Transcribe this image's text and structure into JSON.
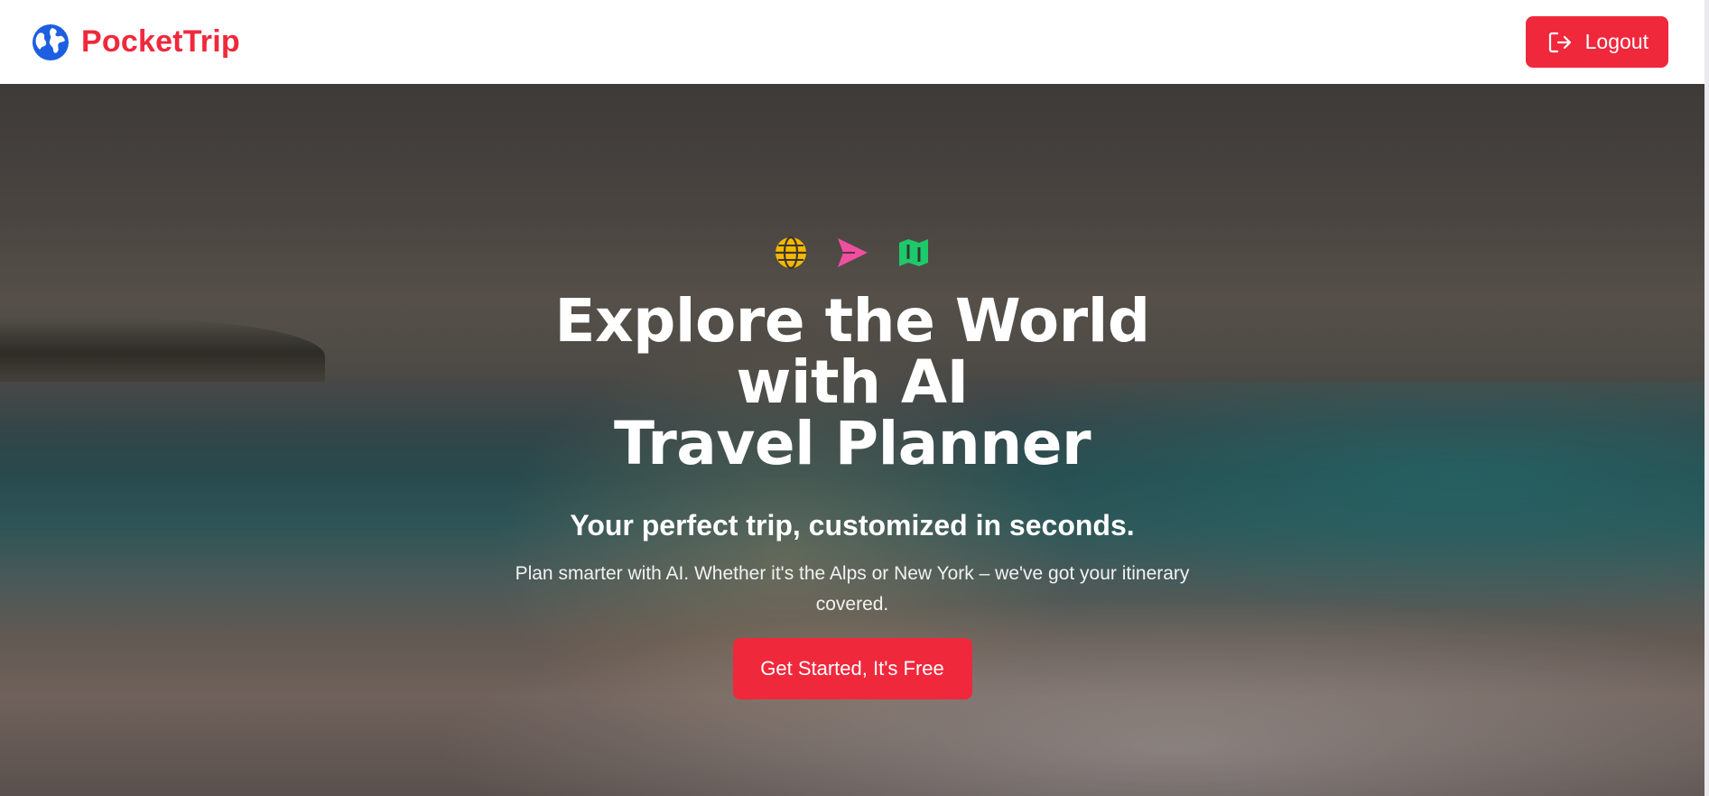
{
  "navbar": {
    "brand_name": "PocketTrip",
    "brand_color": "#f0283c",
    "brand_icon": "globe-icon",
    "logout_label": "Logout",
    "logout_icon": "logout-icon"
  },
  "hero": {
    "icons": [
      "globe-icon",
      "paper-plane-icon",
      "map-icon"
    ],
    "icon_colors": [
      "#f5b800",
      "#f04fa0",
      "#1ec96a"
    ],
    "title_line1": "Explore the World with AI",
    "title_line2": "Travel Planner",
    "subtitle": "Your perfect trip, customized in seconds.",
    "description": "Plan smarter with AI. Whether it's the Alps or New York – we've got your itinerary covered.",
    "cta_label": "Get Started, It's Free"
  },
  "colors": {
    "accent": "#f0283c",
    "brand_icon": "#1d5fe0"
  }
}
